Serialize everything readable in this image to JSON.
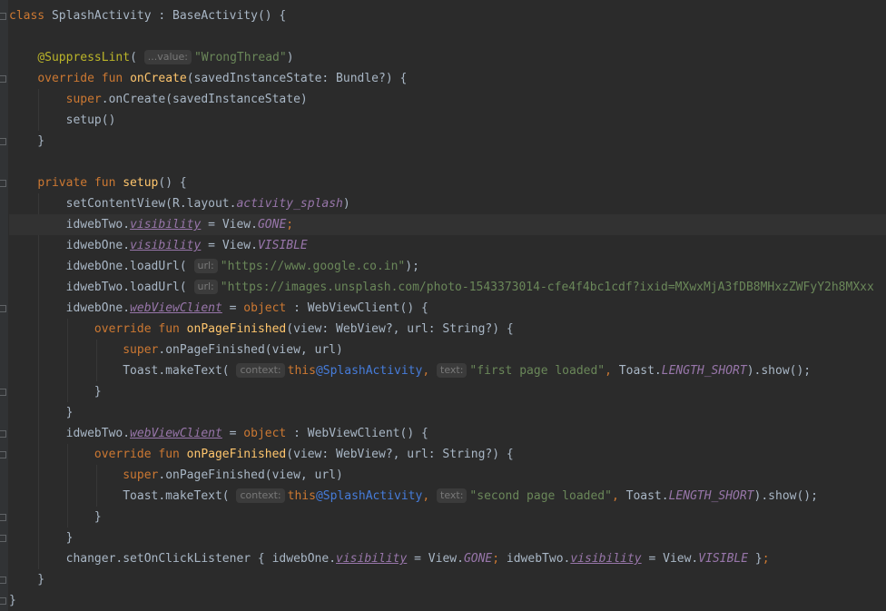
{
  "editor": {
    "language": "Kotlin",
    "lines": [
      {
        "segments": [
          {
            "t": "kw",
            "v": "class "
          },
          {
            "t": "plain",
            "v": "SplashActivity : BaseActivity() {"
          }
        ]
      },
      {
        "segments": []
      },
      {
        "segments": [
          {
            "t": "plain",
            "v": "    "
          },
          {
            "t": "ann",
            "v": "@SuppressLint"
          },
          {
            "t": "plain",
            "v": "( "
          },
          {
            "t": "hint",
            "v": "...value:"
          },
          {
            "t": "str",
            "v": "\"WrongThread\""
          },
          {
            "t": "plain",
            "v": ")"
          }
        ]
      },
      {
        "segments": [
          {
            "t": "plain",
            "v": "    "
          },
          {
            "t": "kw",
            "v": "override fun "
          },
          {
            "t": "fn",
            "v": "onCreate"
          },
          {
            "t": "plain",
            "v": "(savedInstanceState: Bundle?) {"
          }
        ]
      },
      {
        "segments": [
          {
            "t": "plain",
            "v": "        "
          },
          {
            "t": "kw",
            "v": "super"
          },
          {
            "t": "plain",
            "v": ".onCreate(savedInstanceState)"
          }
        ]
      },
      {
        "segments": [
          {
            "t": "plain",
            "v": "        setup()"
          }
        ]
      },
      {
        "segments": [
          {
            "t": "plain",
            "v": "    }"
          }
        ]
      },
      {
        "segments": []
      },
      {
        "segments": [
          {
            "t": "plain",
            "v": "    "
          },
          {
            "t": "kw",
            "v": "private fun "
          },
          {
            "t": "fn",
            "v": "setup"
          },
          {
            "t": "plain",
            "v": "() {"
          }
        ]
      },
      {
        "segments": [
          {
            "t": "plain",
            "v": "        setContentView(R.layout."
          },
          {
            "t": "it",
            "v": "activity_splash"
          },
          {
            "t": "plain",
            "v": ")"
          }
        ]
      },
      {
        "segments": [
          {
            "t": "plain",
            "v": "        idwebTwo."
          },
          {
            "t": "prop",
            "v": "visibility"
          },
          {
            "t": "plain",
            "v": " = View."
          },
          {
            "t": "it",
            "v": "GONE"
          },
          {
            "t": "kw",
            "v": ";"
          }
        ]
      },
      {
        "segments": [
          {
            "t": "plain",
            "v": "        idwebOne."
          },
          {
            "t": "prop",
            "v": "visibility"
          },
          {
            "t": "plain",
            "v": " = View."
          },
          {
            "t": "it",
            "v": "VISIBLE"
          }
        ]
      },
      {
        "segments": [
          {
            "t": "plain",
            "v": "        idwebOne.loadUrl( "
          },
          {
            "t": "hint",
            "v": "url:"
          },
          {
            "t": "str",
            "v": "\"https://www.google.co.in\""
          },
          {
            "t": "plain",
            "v": ");"
          }
        ]
      },
      {
        "segments": [
          {
            "t": "plain",
            "v": "        idwebTwo.loadUrl( "
          },
          {
            "t": "hint",
            "v": "url:"
          },
          {
            "t": "str",
            "v": "\"https://images.unsplash.com/photo-1543373014-cfe4f4bc1cdf?ixid=MXwxMjA3fDB8MHxzZWFyY2h8MXxx"
          }
        ]
      },
      {
        "segments": [
          {
            "t": "plain",
            "v": "        idwebOne."
          },
          {
            "t": "prop",
            "v": "webViewClient"
          },
          {
            "t": "plain",
            "v": " = "
          },
          {
            "t": "kw",
            "v": "object"
          },
          {
            "t": "plain",
            "v": " : WebViewClient() {"
          }
        ]
      },
      {
        "segments": [
          {
            "t": "plain",
            "v": "            "
          },
          {
            "t": "kw",
            "v": "override fun "
          },
          {
            "t": "fn",
            "v": "onPageFinished"
          },
          {
            "t": "plain",
            "v": "(view: WebView?, url: String?) {"
          }
        ]
      },
      {
        "segments": [
          {
            "t": "plain",
            "v": "                "
          },
          {
            "t": "kw",
            "v": "super"
          },
          {
            "t": "plain",
            "v": ".onPageFinished(view, url)"
          }
        ]
      },
      {
        "segments": [
          {
            "t": "plain",
            "v": "                Toast.makeText( "
          },
          {
            "t": "hint",
            "v": "context:"
          },
          {
            "t": "kw",
            "v": "this"
          },
          {
            "t": "at",
            "v": "@SplashActivity"
          },
          {
            "t": "kw",
            "v": ", "
          },
          {
            "t": "hint",
            "v": "text:"
          },
          {
            "t": "str",
            "v": "\"first page loaded\""
          },
          {
            "t": "kw",
            "v": ", "
          },
          {
            "t": "plain",
            "v": "Toast."
          },
          {
            "t": "it",
            "v": "LENGTH_SHORT"
          },
          {
            "t": "plain",
            "v": ").show();"
          }
        ]
      },
      {
        "segments": [
          {
            "t": "plain",
            "v": "            }"
          }
        ]
      },
      {
        "segments": [
          {
            "t": "plain",
            "v": "        }"
          }
        ]
      },
      {
        "segments": [
          {
            "t": "plain",
            "v": "        idwebTwo."
          },
          {
            "t": "prop",
            "v": "webViewClient"
          },
          {
            "t": "plain",
            "v": " = "
          },
          {
            "t": "kw",
            "v": "object"
          },
          {
            "t": "plain",
            "v": " : WebViewClient() {"
          }
        ]
      },
      {
        "segments": [
          {
            "t": "plain",
            "v": "            "
          },
          {
            "t": "kw",
            "v": "override fun "
          },
          {
            "t": "fn",
            "v": "onPageFinished"
          },
          {
            "t": "plain",
            "v": "(view: WebView?, url: String?) {"
          }
        ]
      },
      {
        "segments": [
          {
            "t": "plain",
            "v": "                "
          },
          {
            "t": "kw",
            "v": "super"
          },
          {
            "t": "plain",
            "v": ".onPageFinished(view, url)"
          }
        ]
      },
      {
        "segments": [
          {
            "t": "plain",
            "v": "                Toast.makeText( "
          },
          {
            "t": "hint",
            "v": "context:"
          },
          {
            "t": "kw",
            "v": "this"
          },
          {
            "t": "at",
            "v": "@SplashActivity"
          },
          {
            "t": "kw",
            "v": ", "
          },
          {
            "t": "hint",
            "v": "text:"
          },
          {
            "t": "str",
            "v": "\"second page loaded\""
          },
          {
            "t": "kw",
            "v": ", "
          },
          {
            "t": "plain",
            "v": "Toast."
          },
          {
            "t": "it",
            "v": "LENGTH_SHORT"
          },
          {
            "t": "plain",
            "v": ").show();"
          }
        ]
      },
      {
        "segments": [
          {
            "t": "plain",
            "v": "            }"
          }
        ]
      },
      {
        "segments": [
          {
            "t": "plain",
            "v": "        }"
          }
        ]
      },
      {
        "segments": [
          {
            "t": "plain",
            "v": "        changer.setOnClickListener { idwebOne."
          },
          {
            "t": "prop",
            "v": "visibility"
          },
          {
            "t": "plain",
            "v": " = View."
          },
          {
            "t": "it",
            "v": "GONE"
          },
          {
            "t": "kw",
            "v": "; "
          },
          {
            "t": "plain",
            "v": "idwebTwo."
          },
          {
            "t": "prop",
            "v": "visibility"
          },
          {
            "t": "plain",
            "v": " = View."
          },
          {
            "t": "it",
            "v": "VISIBLE"
          },
          {
            "t": "plain",
            "v": " }"
          },
          {
            "t": "kw",
            "v": ";"
          }
        ]
      },
      {
        "segments": [
          {
            "t": "plain",
            "v": "    }"
          }
        ]
      },
      {
        "segments": [
          {
            "t": "plain",
            "v": "}"
          }
        ]
      }
    ]
  },
  "colors": {
    "background": "#2b2b2b",
    "keyword": "#cc7832",
    "function": "#ffc66d",
    "string": "#6a8759",
    "annotation": "#bbb529",
    "constant": "#9876aa",
    "text": "#a9b7c6"
  }
}
